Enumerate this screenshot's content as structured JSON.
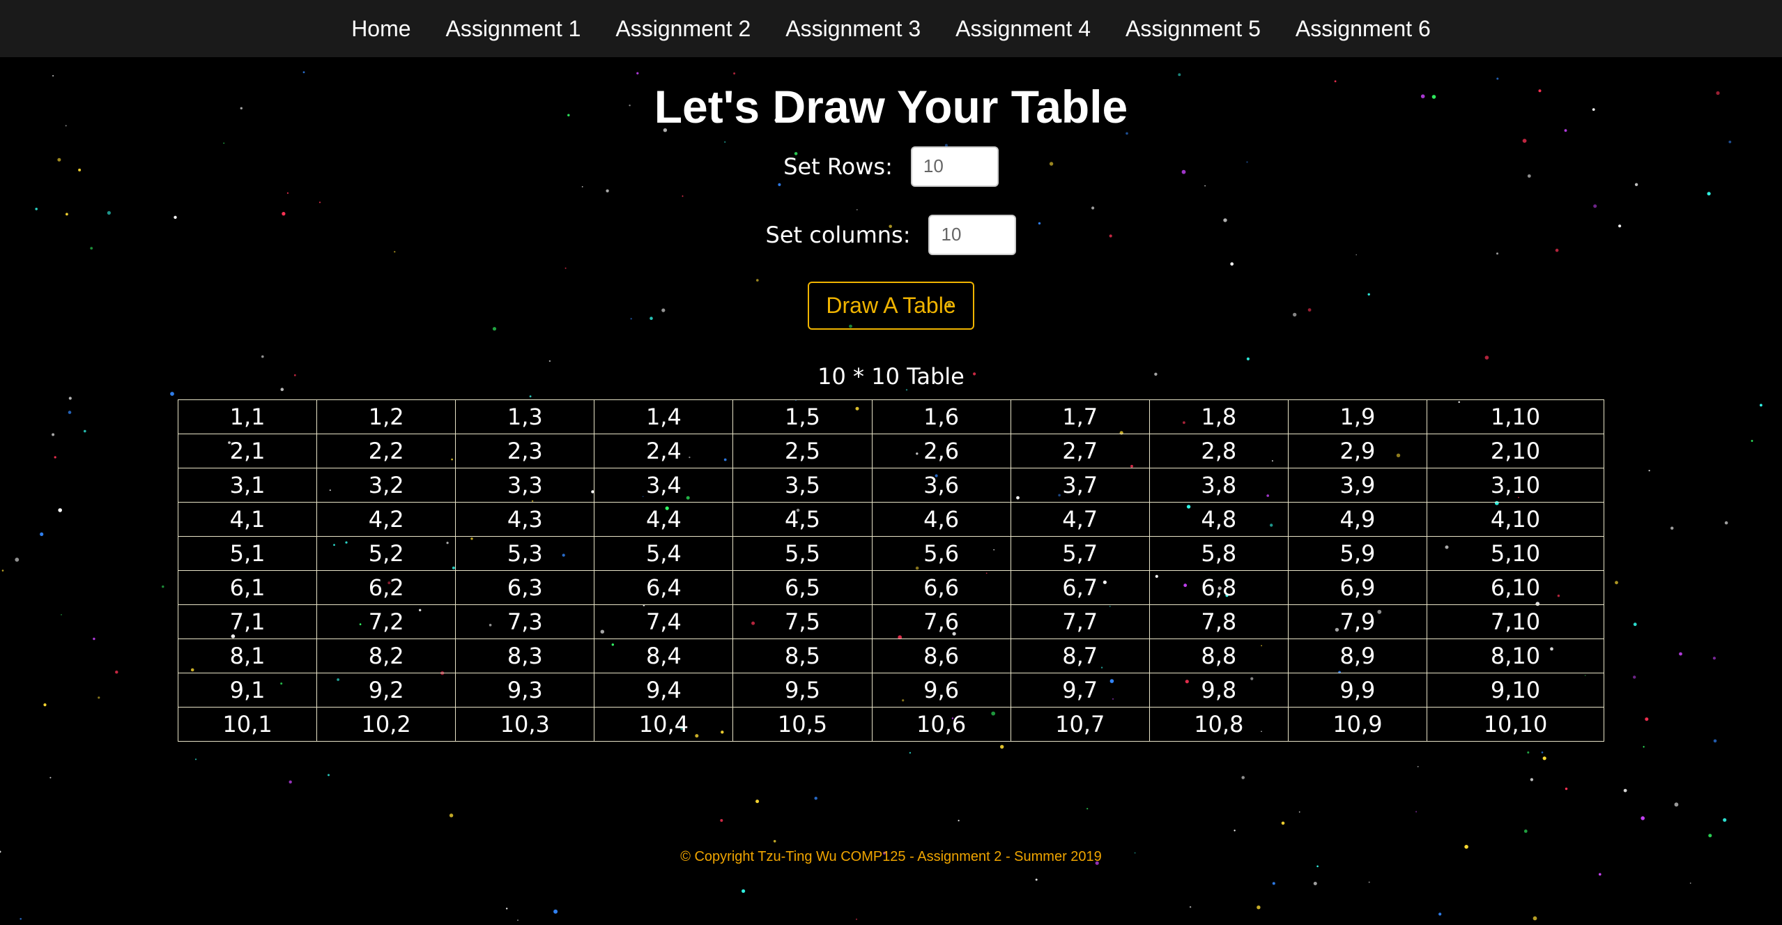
{
  "nav": {
    "items": [
      {
        "label": "Home"
      },
      {
        "label": "Assignment 1"
      },
      {
        "label": "Assignment 2"
      },
      {
        "label": "Assignment 3"
      },
      {
        "label": "Assignment 4"
      },
      {
        "label": "Assignment 5"
      },
      {
        "label": "Assignment 6"
      }
    ]
  },
  "main": {
    "title": "Let's Draw Your Table",
    "rows_label": "Set Rows:",
    "rows_value": "10",
    "cols_label": "Set columns:",
    "cols_value": "10",
    "draw_button": "Draw A Table",
    "table_caption": "10 * 10 Table",
    "table": [
      [
        "1,1",
        "1,2",
        "1,3",
        "1,4",
        "1,5",
        "1,6",
        "1,7",
        "1,8",
        "1,9",
        "1,10"
      ],
      [
        "2,1",
        "2,2",
        "2,3",
        "2,4",
        "2,5",
        "2,6",
        "2,7",
        "2,8",
        "2,9",
        "2,10"
      ],
      [
        "3,1",
        "3,2",
        "3,3",
        "3,4",
        "3,5",
        "3,6",
        "3,7",
        "3,8",
        "3,9",
        "3,10"
      ],
      [
        "4,1",
        "4,2",
        "4,3",
        "4,4",
        "4,5",
        "4,6",
        "4,7",
        "4,8",
        "4,9",
        "4,10"
      ],
      [
        "5,1",
        "5,2",
        "5,3",
        "5,4",
        "5,5",
        "5,6",
        "5,7",
        "5,8",
        "5,9",
        "5,10"
      ],
      [
        "6,1",
        "6,2",
        "6,3",
        "6,4",
        "6,5",
        "6,6",
        "6,7",
        "6,8",
        "6,9",
        "6,10"
      ],
      [
        "7,1",
        "7,2",
        "7,3",
        "7,4",
        "7,5",
        "7,6",
        "7,7",
        "7,8",
        "7,9",
        "7,10"
      ],
      [
        "8,1",
        "8,2",
        "8,3",
        "8,4",
        "8,5",
        "8,6",
        "8,7",
        "8,8",
        "8,9",
        "8,10"
      ],
      [
        "9,1",
        "9,2",
        "9,3",
        "9,4",
        "9,5",
        "9,6",
        "9,7",
        "9,8",
        "9,9",
        "9,10"
      ],
      [
        "10,1",
        "10,2",
        "10,3",
        "10,4",
        "10,5",
        "10,6",
        "10,7",
        "10,8",
        "10,9",
        "10,10"
      ]
    ]
  },
  "footer": {
    "text": "© Copyright Tzu-Ting Wu COMP125 - Assignment 2 - Summer 2019"
  },
  "colors": {
    "background": "#000000",
    "navbar": "#1a1a1a",
    "accent": "#f0b400",
    "footer_text": "#f0a500",
    "table_border": "#e8e4c8"
  }
}
